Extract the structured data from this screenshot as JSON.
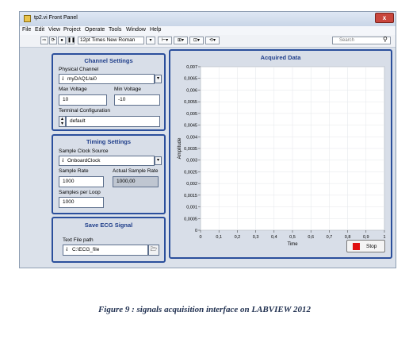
{
  "window": {
    "title": "tp2.vi Front Panel",
    "close_label": "x"
  },
  "menu": [
    "File",
    "Edit",
    "View",
    "Project",
    "Operate",
    "Tools",
    "Window",
    "Help"
  ],
  "toolbar": {
    "font": "12pt Times New Roman",
    "search_placeholder": "Search"
  },
  "channel_settings": {
    "title": "Channel Settings",
    "physical_channel_label": "Physical Channel",
    "physical_channel_value": "myDAQ1/ai0",
    "max_voltage_label": "Max Voltage",
    "max_voltage_value": "10",
    "min_voltage_label": "Min Voltage",
    "min_voltage_value": "-10",
    "terminal_label": "Terminal Configuration",
    "terminal_value": "default"
  },
  "timing_settings": {
    "title": "Timing Settings",
    "clock_source_label": "Sample Clock Source",
    "clock_source_value": "OnboardClock",
    "sample_rate_label": "Sample Rate",
    "sample_rate_value": "1000",
    "actual_rate_label": "Actual Sample Rate",
    "actual_rate_value": "1000,00",
    "samples_per_loop_label": "Samples per Loop",
    "samples_per_loop_value": "1000"
  },
  "save_ecg": {
    "title": "Save ECG Signal",
    "path_label": "Text File path",
    "path_value": "C:\\ECG_file"
  },
  "graph": {
    "title": "Acquired Data",
    "y_axis_label": "Amplitude",
    "x_axis_label": "Time",
    "y_ticks": [
      "0,007",
      "0,0065",
      "0,006",
      "0,0055",
      "0,005",
      "0,0045",
      "0,004",
      "0,0035",
      "0,003",
      "0,0025",
      "0,002",
      "0,0015",
      "0,001",
      "0,0005",
      "0"
    ],
    "x_ticks": [
      "0",
      "0,1",
      "0,2",
      "0,3",
      "0,4",
      "0,5",
      "0,6",
      "0,7",
      "0,8",
      "0,9",
      "1"
    ],
    "stop_label": "Stop",
    "stop_color": "#e01010"
  },
  "caption": "Figure 9 : signals acquisition interface  on LABVIEW 2012"
}
